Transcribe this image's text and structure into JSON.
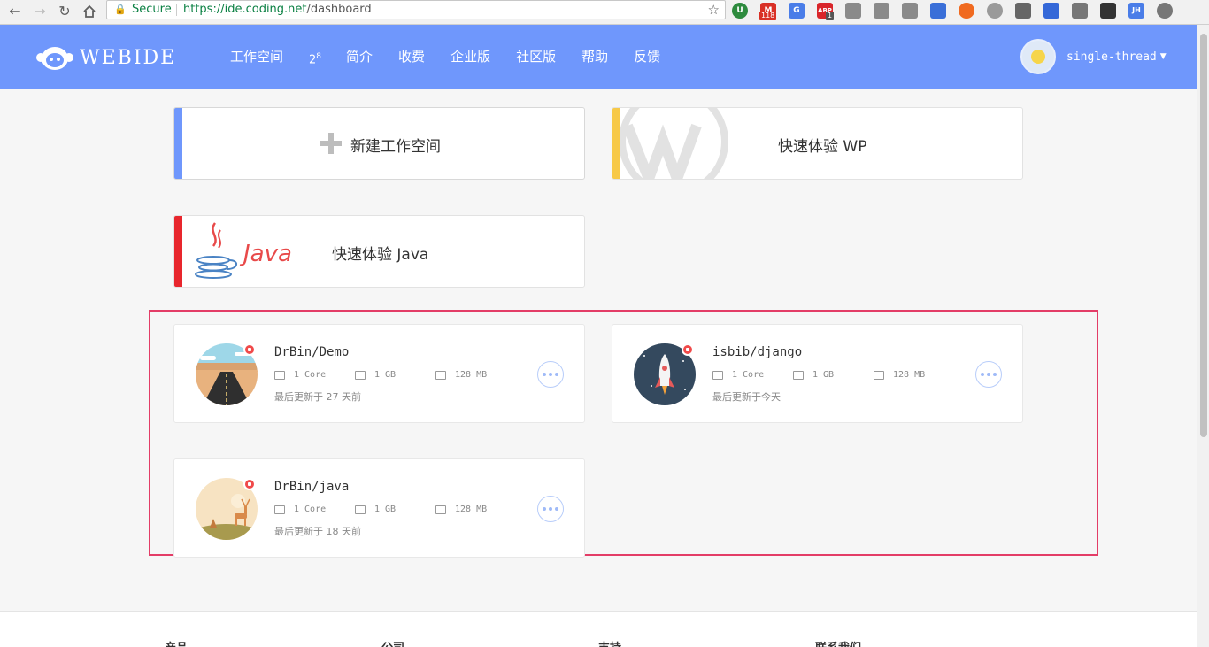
{
  "browser": {
    "secure_label": "Secure",
    "url_host": "https://ide.coding.net",
    "url_path": "/dashboard",
    "ext_badges": {
      "gmail": "118",
      "abp": "1"
    },
    "ext_labels": {
      "abp": "ABP",
      "jh": "JH",
      "g": "G"
    }
  },
  "header": {
    "logo_text": "WEBIDE",
    "nav": [
      "工作空间",
      "2",
      "简介",
      "收费",
      "企业版",
      "社区版",
      "帮助",
      "反馈"
    ],
    "nav_sup": "8",
    "username": "single-thread"
  },
  "quick": {
    "new_workspace": "新建工作空间",
    "try_wp": "快速体验 WP",
    "try_java": "快速体验 Java",
    "java_logo_text": "Java"
  },
  "workspaces": [
    {
      "name": "DrBin/Demo",
      "cpu": "1 Core",
      "disk": "1 GB",
      "memory": "128 MB",
      "updated": "最后更新于 27 天前"
    },
    {
      "name": "isbib/django",
      "cpu": "1 Core",
      "disk": "1 GB",
      "memory": "128 MB",
      "updated": "最后更新于今天"
    },
    {
      "name": "DrBin/java",
      "cpu": "1 Core",
      "disk": "1 GB",
      "memory": "128 MB",
      "updated": "最后更新于 18 天前"
    }
  ],
  "footer": {
    "columns": [
      "产品",
      "公司",
      "支持",
      "联系我们"
    ]
  },
  "colors": {
    "header": "#6f97fc",
    "stripe_new": "#6f97fc",
    "stripe_wp": "#f7c948",
    "stripe_java": "#e8262d",
    "highlight": "#e33d67",
    "status": "#f04a4a"
  }
}
